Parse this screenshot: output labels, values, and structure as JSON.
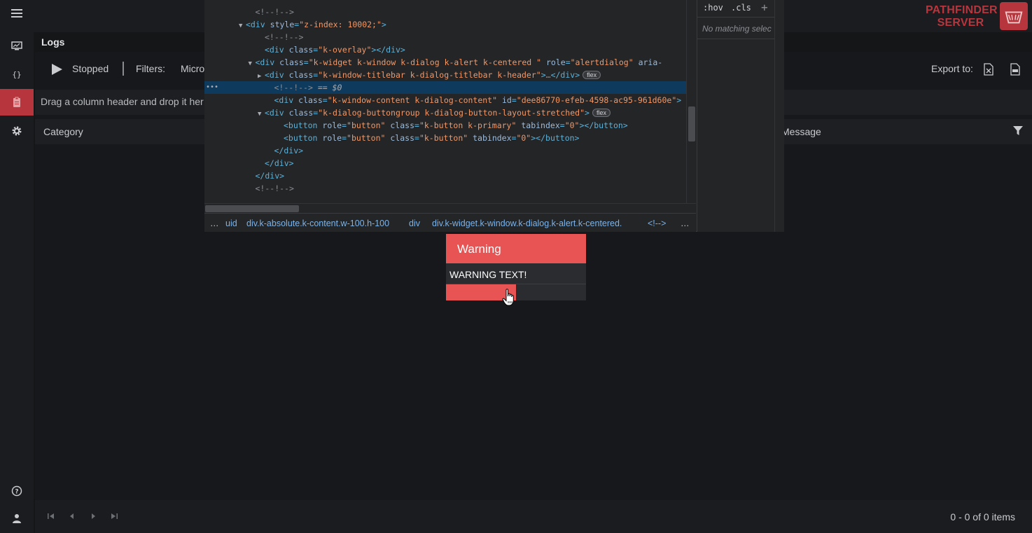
{
  "header": {
    "brand_line1": "PATHFINDER",
    "brand_line2": "SERVER"
  },
  "nav": {
    "items": [
      "menu-icon",
      "monitor-icon",
      "braces-icon",
      "clipboard-icon",
      "gear-icon",
      "help-icon",
      "user-icon"
    ],
    "active": "clipboard-icon"
  },
  "logs": {
    "title": "Logs",
    "status": "Stopped",
    "filters_label": "Filters:",
    "filter_value": "Micro",
    "export_label": "Export to:",
    "group_hint": "Drag a column header and drop it her",
    "columns": {
      "category": "Category",
      "message": "Message"
    },
    "pager_info": "0 - 0 of 0 items"
  },
  "devtools": {
    "lines": [
      {
        "indent": 5,
        "text": "<!--!-->",
        "kind": "comment"
      },
      {
        "indent": 4,
        "tag": "div",
        "attrs": [
          [
            "style",
            "z-index: 10002;"
          ]
        ],
        "open": true
      },
      {
        "indent": 6,
        "text": "<!--!-->",
        "kind": "comment"
      },
      {
        "indent": 6,
        "tag": "div",
        "attrs": [
          [
            "class",
            "k-overlay"
          ]
        ],
        "close": true
      },
      {
        "indent": 5,
        "tag": "div",
        "attrs": [
          [
            "class",
            "k-widget k-window k-dialog k-alert k-centered "
          ],
          [
            "role",
            "alertdialog"
          ],
          [
            "aria-",
            ""
          ]
        ],
        "open": true
      },
      {
        "indent": 6,
        "tag": "div",
        "attrs": [
          [
            "class",
            "k-window-titlebar k-dialog-titlebar k-header"
          ]
        ],
        "collapsed": true,
        "badge": "flex"
      },
      {
        "indent": 7,
        "text": "<!--!--> == $0",
        "kind": "selected"
      },
      {
        "indent": 7,
        "tag": "div",
        "attrs": [
          [
            "class",
            "k-window-content k-dialog-content"
          ],
          [
            "id",
            "dee86770-efeb-4598-ac95-961d60e"
          ]
        ]
      },
      {
        "indent": 6,
        "tag": "div",
        "attrs": [
          [
            "class",
            "k-dialog-buttongroup k-dialog-button-layout-stretched"
          ]
        ],
        "open": true,
        "badge": "flex"
      },
      {
        "indent": 8,
        "tag": "button",
        "attrs": [
          [
            "role",
            "button"
          ],
          [
            "class",
            "k-button k-primary"
          ],
          [
            "tabindex",
            "0"
          ]
        ],
        "close": true
      },
      {
        "indent": 8,
        "tag": "button",
        "attrs": [
          [
            "role",
            "button"
          ],
          [
            "class",
            "k-button"
          ],
          [
            "tabindex",
            "0"
          ]
        ],
        "close": true
      },
      {
        "indent": 7,
        "text": "</div>",
        "kind": "end"
      },
      {
        "indent": 6,
        "text": "</div>",
        "kind": "end"
      },
      {
        "indent": 5,
        "text": "</div>",
        "kind": "end"
      },
      {
        "indent": 5,
        "text": "<!--!-->",
        "kind": "comment"
      }
    ],
    "breadcrumbs": [
      "...",
      "uid",
      "div.k-absolute.k-content.w-100.h-100",
      "div",
      "div.k-widget.k-window.k-dialog.k-alert.k-centered.",
      "<!-->",
      "..."
    ],
    "styles_hov": ":hov",
    "styles_cls": ".cls",
    "styles_plus": "+",
    "styles_empty": "No matching selec"
  },
  "dialog": {
    "title": "Warning",
    "content": "WARNING TEXT!"
  },
  "colors": {
    "accent": "#b7363d",
    "dialog_red": "#e85454",
    "selection": "#0e3a5e"
  }
}
